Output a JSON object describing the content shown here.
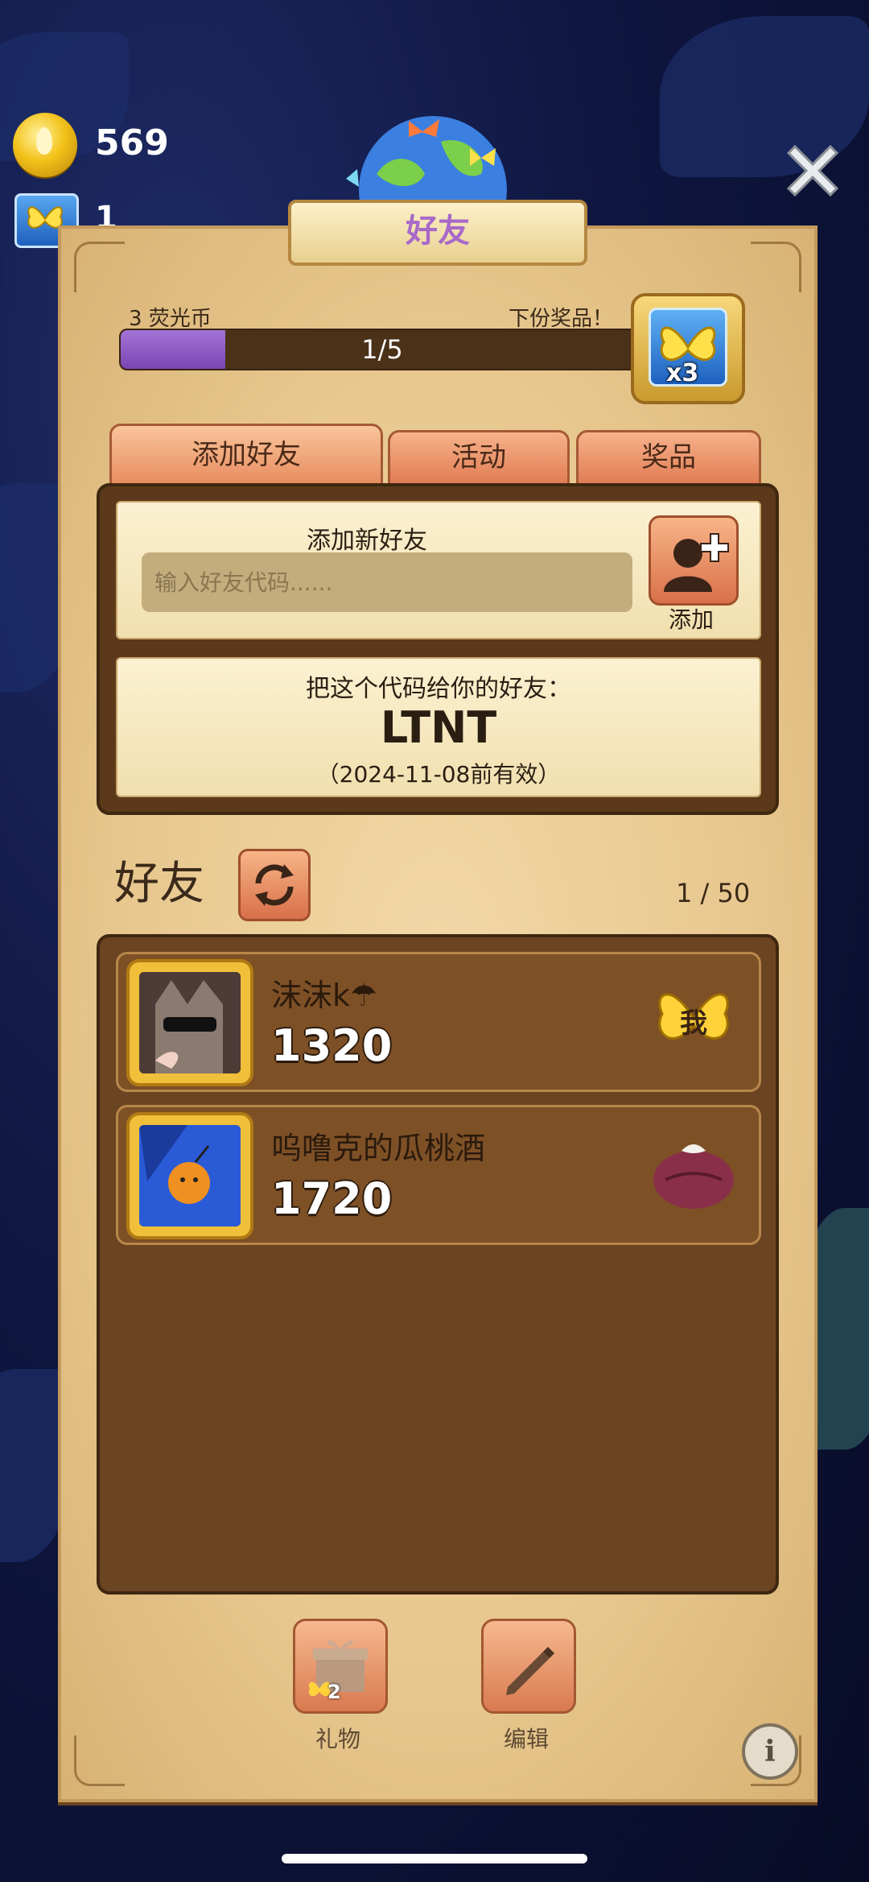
{
  "hud": {
    "coins": "569",
    "butterflies": "1"
  },
  "title": "好友",
  "progress": {
    "left_label": "3 荧光币",
    "right_label": "下份奖品！",
    "text": "1/5",
    "fraction": 0.2,
    "reward_qty": "x3"
  },
  "tabs": [
    {
      "label": "添加好友",
      "active": true
    },
    {
      "label": "活动",
      "active": false
    },
    {
      "label": "奖品",
      "active": false
    }
  ],
  "add_friend": {
    "title": "添加新好友",
    "placeholder": "输入好友代码......",
    "button_label": "添加"
  },
  "share": {
    "prompt": "把这个代码给你的好友：",
    "code": "LTNT",
    "valid": "（2024-11-08前有效）"
  },
  "friends": {
    "heading": "好友",
    "count": "1 / 50",
    "items": [
      {
        "name": "沫沫k☂",
        "score": "1320",
        "badge": "我",
        "badge_icon": "butterfly-me-badge"
      },
      {
        "name": "呜噜克的瓜桃酒",
        "score": "1720",
        "badge": "",
        "badge_icon": "gift-bag-icon"
      }
    ]
  },
  "bottom": {
    "gift_label": "礼物",
    "gift_qty": "2",
    "edit_label": "编辑"
  },
  "colors": {
    "progress_fill": "#8b55c4",
    "panel": "#e7c78e",
    "list_bg": "#6b4422",
    "tab": "#e88a5e"
  }
}
